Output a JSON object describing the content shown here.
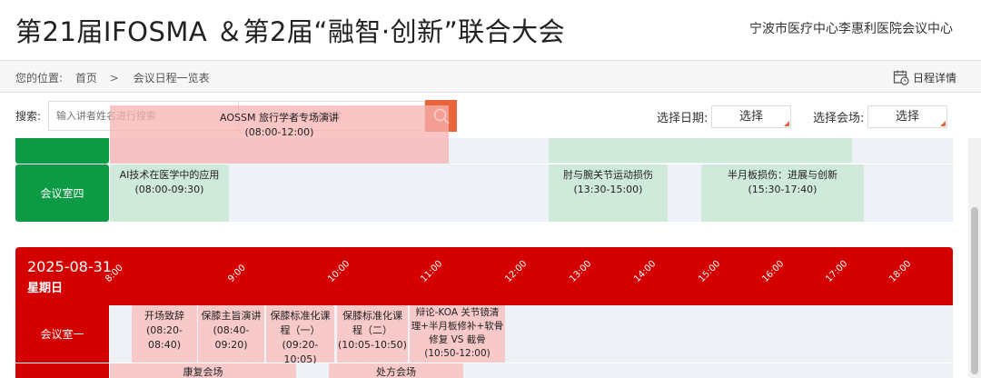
{
  "header": {
    "title": "第21届IFOSMA ＆第2届“融智·创新”联合大会",
    "org": "宁波市医疗中心李惠利医院会议中心"
  },
  "breadcrumb": {
    "prefix": "您的位置:",
    "home": "首页",
    "separator": ">",
    "current": "会议日程一览表",
    "detail_label": "日程详情"
  },
  "search": {
    "label": "搜索:",
    "placeholder_speaker": "输入讲者姓名进行搜索",
    "placeholder_topic": "行搜索",
    "date_label": "选择日期:",
    "date_value": "选择",
    "venue_label": "选择会场:",
    "venue_value": "选择"
  },
  "floating_event": {
    "title": "AOSSM 旅行学者专场演讲",
    "time": "(08:00-12:00)"
  },
  "day_prev": {
    "room": "会议室四",
    "events": [
      {
        "title": "AI技术在医学中的应用",
        "time": "(08:00-09:30)"
      },
      {
        "title": "肘与腕关节运动损伤",
        "time": "(13:30-15:00)"
      },
      {
        "title": "半月板损伤：进展与创新",
        "time": "(15:30-17:40)"
      }
    ]
  },
  "day": {
    "date": "2025-08-31",
    "weekday": "星期日",
    "ticks": [
      "8:00",
      "9:00",
      "10:00",
      "11:00",
      "12:00",
      "13:00",
      "14:00",
      "15:00",
      "16:00",
      "17:00",
      "18:00"
    ],
    "room1": "会议室一",
    "room1_events": [
      {
        "line1": "开场致辞",
        "line2": "(08:20-08:40)"
      },
      {
        "line1": "保膝主旨演讲",
        "line2": "(08:40-09:20)"
      },
      {
        "line1": "保膝标准化课",
        "line2": "程（一）",
        "line3": "(09:20-10:05)"
      },
      {
        "line1": "保膝标准化课",
        "line2": "程（二）",
        "line3": "(10:05-10:50)"
      },
      {
        "line1": "辩论-KOA 关节镜清",
        "line2": "理+半月板修补+软骨",
        "line3": "修复 VS 截骨",
        "line4": "(10:50-12:00)"
      }
    ],
    "room2_events": [
      {
        "title": "康复会场"
      },
      {
        "title": "处方会场"
      }
    ]
  }
}
